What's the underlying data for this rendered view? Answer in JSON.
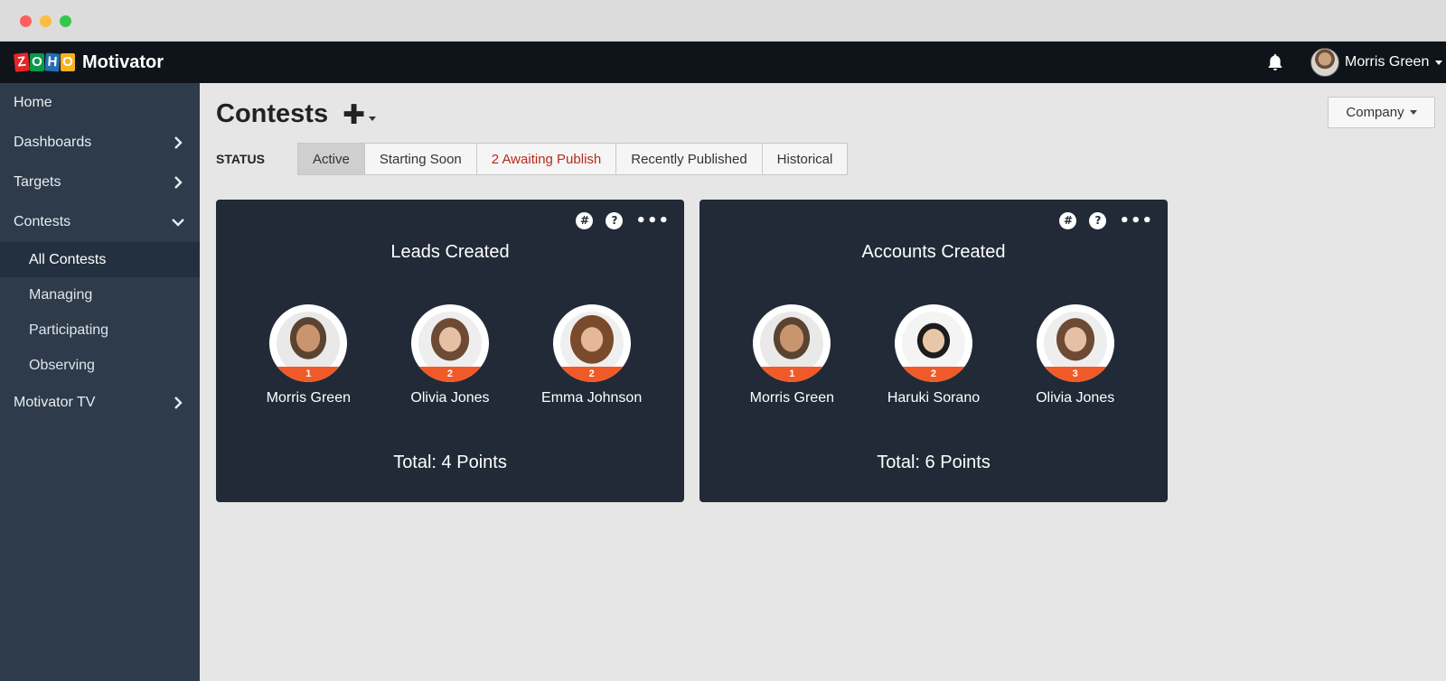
{
  "window": {
    "traffic_lights": [
      "#fc605c",
      "#fdbc40",
      "#34c84a"
    ]
  },
  "brand": {
    "logo_letters": [
      "Z",
      "O",
      "H",
      "O"
    ],
    "app_name": "Motivator",
    "colors": {
      "topbar": "#0f141a",
      "sidebar": "#2d3b4a",
      "card": "#212a36",
      "rank_badge": "#f05a28",
      "warning_tab": "#b42b1e"
    }
  },
  "header": {
    "notification_icon": "bell-icon",
    "user_name": "Morris Green"
  },
  "sidebar": {
    "items": [
      {
        "label": "Home",
        "has_chevron": false
      },
      {
        "label": "Dashboards",
        "has_chevron": true,
        "chevron": "chevron-right-icon"
      },
      {
        "label": "Targets",
        "has_chevron": true,
        "chevron": "chevron-right-icon"
      },
      {
        "label": "Contests",
        "has_chevron": true,
        "chevron": "chevron-down-icon"
      }
    ],
    "sub_items": [
      "All Contests",
      "Managing",
      "Participating",
      "Observing"
    ],
    "active_sub_item": "All Contests",
    "last_item": {
      "label": "Motivator TV",
      "chevron": "chevron-right-icon"
    }
  },
  "main": {
    "title": "Contests",
    "add_icon": "plus-icon",
    "company_button": "Company",
    "status_label": "STATUS",
    "tabs": [
      {
        "label": "Active",
        "active": true
      },
      {
        "label": "Starting Soon",
        "active": false
      },
      {
        "label": "2 Awaiting Publish",
        "active": false
      },
      {
        "label": "Recently Published",
        "active": false
      },
      {
        "label": "Historical",
        "active": false
      }
    ],
    "card_icons": [
      "hash-icon",
      "help-icon",
      "more-icon"
    ],
    "hash_glyph": "#",
    "help_glyph": "?",
    "more_glyph": "•••",
    "cards": [
      {
        "title": "Leads Created",
        "participants": [
          {
            "name": "Morris Green",
            "rank": "1"
          },
          {
            "name": "Olivia Jones",
            "rank": "2"
          },
          {
            "name": "Emma Johnson",
            "rank": "2"
          }
        ],
        "total": "Total: 4 Points"
      },
      {
        "title": "Accounts Created",
        "participants": [
          {
            "name": "Morris Green",
            "rank": "1"
          },
          {
            "name": "Haruki Sorano",
            "rank": "2"
          },
          {
            "name": "Olivia Jones",
            "rank": "3"
          }
        ],
        "total": "Total: 6 Points"
      }
    ]
  }
}
